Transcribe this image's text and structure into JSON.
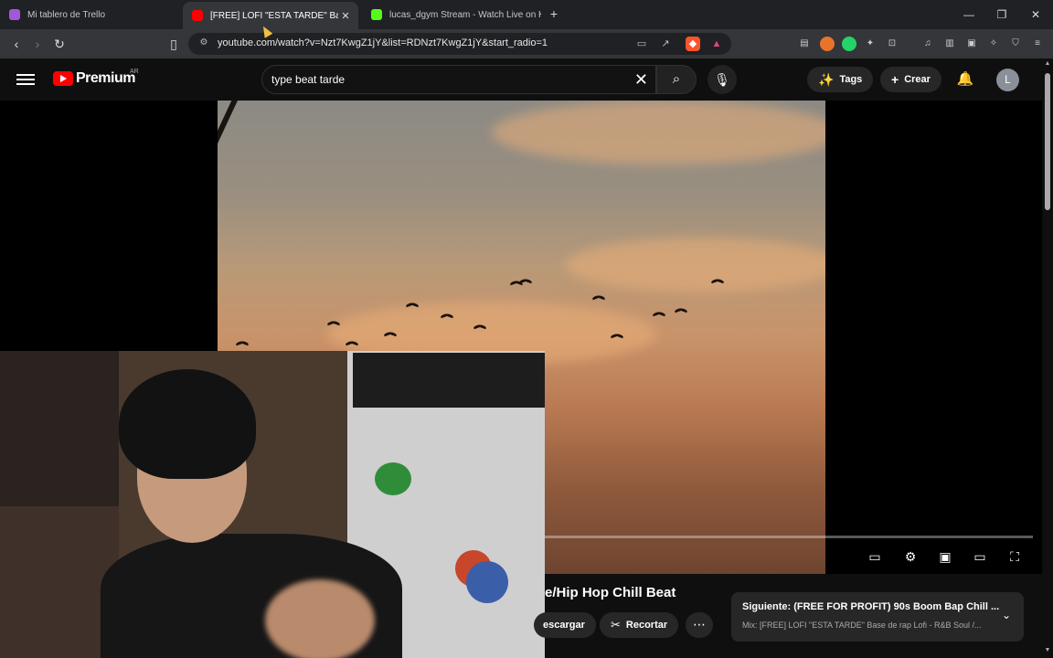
{
  "browser": {
    "tabs": [
      {
        "title": "Mi tablero de Trello",
        "favicon_color": "#a259d9"
      },
      {
        "title": "[FREE] LOFI \"ESTA TARDE\" Base d",
        "favicon_color": "#ff0000"
      },
      {
        "title": "lucas_dgym Stream - Watch Live on K",
        "favicon_color": "#53fc18"
      }
    ],
    "new_tab": "+",
    "url": "youtube.com/watch?v=Nzt7KwgZ1jY&list=RDNzt7KwgZ1jY&start_radio=1"
  },
  "youtube": {
    "logo_text": "Premium",
    "country_code": "AR",
    "search_query": "type beat tarde",
    "tags_label": "Tags",
    "create_label": "Crear",
    "avatar_letter": "L",
    "video_title_fragment": "e/Hip Hop Chill Beat",
    "download_label": "escargar",
    "clip_label": "Recortar",
    "next": {
      "label": "Siguiente: (FREE FOR PROFIT) 90s Boom Bap Chill ...",
      "mix": "Mix: [FREE] LOFI \"ESTA TARDE\" Base de rap Lofi - R&B Soul /..."
    }
  },
  "colors": {
    "accent": "#ff0000",
    "bg": "#0f0f0f",
    "chip": "#272727"
  }
}
